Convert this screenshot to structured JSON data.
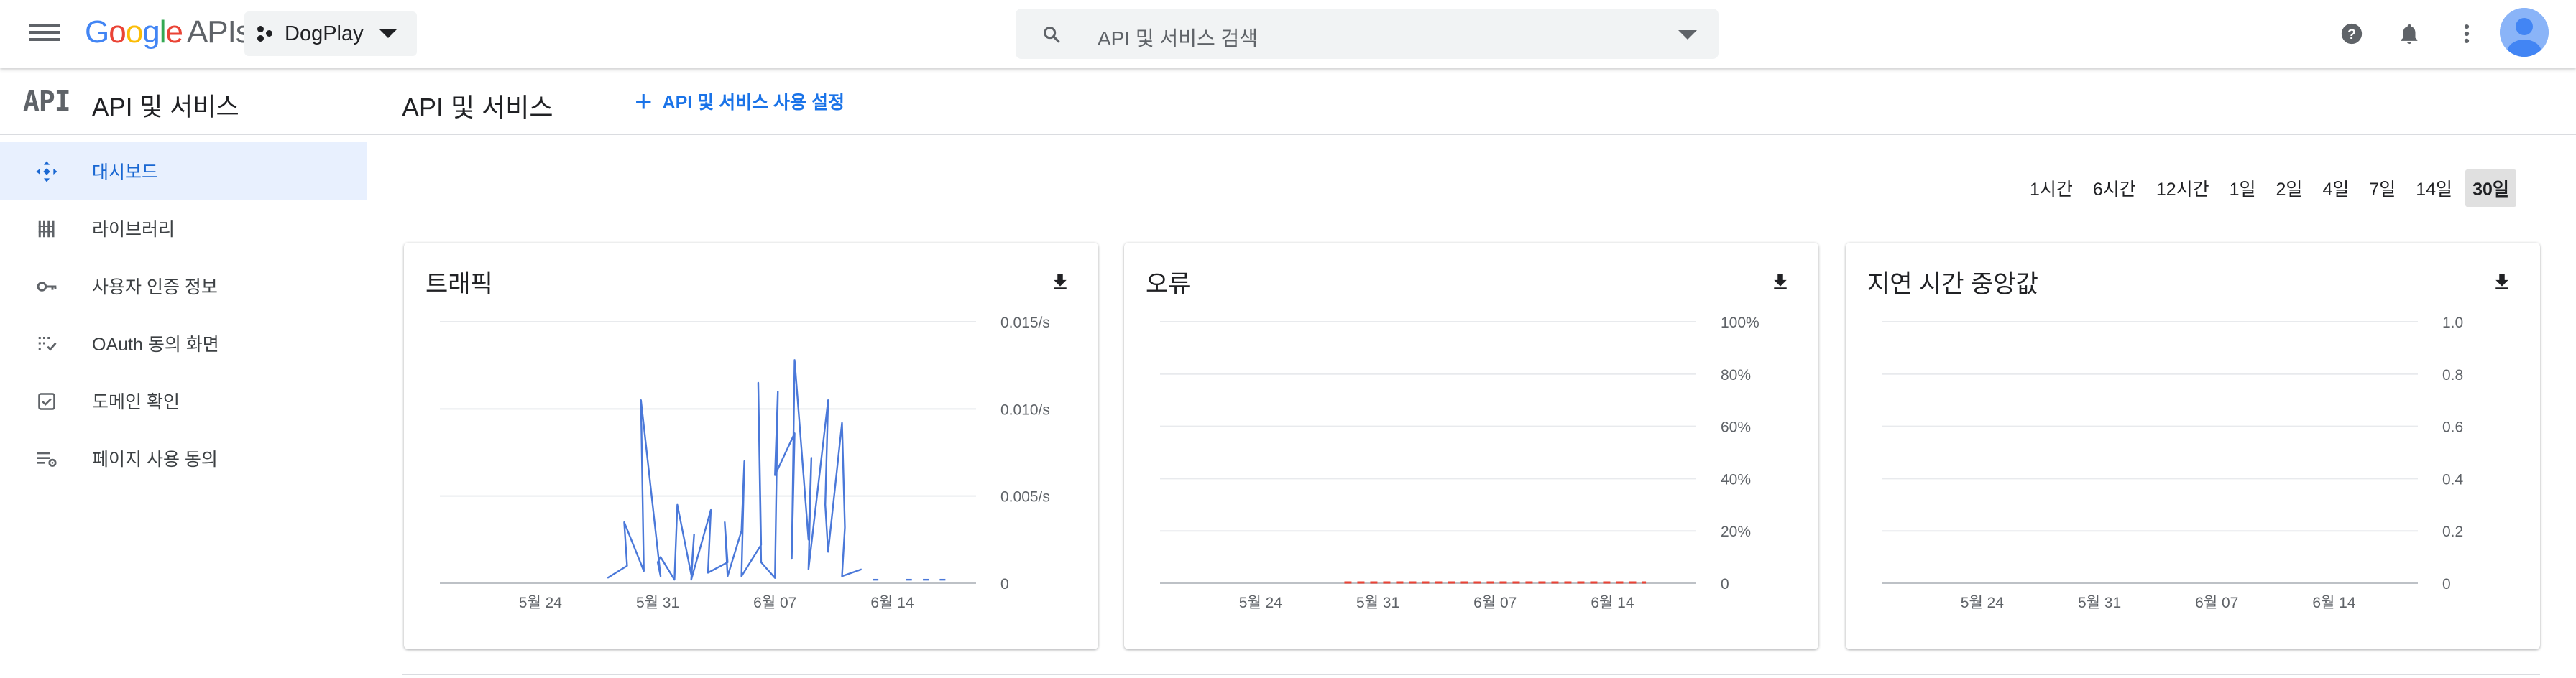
{
  "topbar": {
    "menu_icon": "hamburger-menu-icon",
    "brand_google": "Google",
    "brand_apis": "APIs",
    "project_name": "DogPlay",
    "search_placeholder": "API 및 서비스 검색",
    "help_icon": "help-icon",
    "notifications_icon": "bell-icon",
    "more_icon": "more-vert-icon"
  },
  "sidebar": {
    "logo_text": "API",
    "title": "API 및 서비스",
    "items": [
      {
        "label": "대시보드",
        "icon": "dashboard-icon",
        "active": true
      },
      {
        "label": "라이브러리",
        "icon": "library-icon",
        "active": false
      },
      {
        "label": "사용자 인증 정보",
        "icon": "key-icon",
        "active": false
      },
      {
        "label": "OAuth 동의 화면",
        "icon": "consent-icon",
        "active": false
      },
      {
        "label": "도메인 확인",
        "icon": "checkbox-icon",
        "active": false
      },
      {
        "label": "페이지 사용 동의",
        "icon": "settings-list-icon",
        "active": false
      }
    ]
  },
  "header": {
    "title": "API 및 서비스",
    "enable_button": "API 및 서비스 사용 설정"
  },
  "time_ranges": {
    "options": [
      "1시간",
      "6시간",
      "12시간",
      "1일",
      "2일",
      "4일",
      "7일",
      "14일",
      "30일"
    ],
    "selected": "30일"
  },
  "colors": {
    "accent": "#1a73e8",
    "active_bg": "#e8f0fe",
    "traffic_line": "#4a78d9",
    "error_line": "#ea4335"
  },
  "chart_data": [
    {
      "type": "line",
      "title": "트래픽",
      "x_tick_labels": [
        "5월 24",
        "5월 31",
        "6월 07",
        "6월 14"
      ],
      "y_tick_labels": [
        "0.015/s",
        "0.010/s",
        "0.005/s",
        "0"
      ],
      "ylim": [
        0,
        0.015
      ],
      "grid": true,
      "series": [
        {
          "x": [
            "5월 28",
            "5월 29",
            "5월 29",
            "5월 30",
            "5월 30",
            "5월 31",
            "5월 31",
            "5월 31",
            "6월 01",
            "6월 01",
            "6월 02",
            "6월 02",
            "6월 02",
            "6월 03",
            "6월 03",
            "6월 04",
            "6월 04",
            "6월 04",
            "6월 05",
            "6월 05",
            "6월 05",
            "6월 06",
            "6월 06",
            "6월 06",
            "6월 07",
            "6월 07",
            "6월 07",
            "6월 08",
            "6월 08",
            "6월 08",
            "6월 09",
            "6월 09",
            "6월 09",
            "6월 10",
            "6월 10",
            "6월 10",
            "6월 11",
            "6월 11",
            "6월 11",
            "6월 12"
          ],
          "y": [
            0.0003,
            0.001,
            0.0035,
            0.0007,
            0.0105,
            0.0004,
            0.0012,
            0.0015,
            0.0002,
            0.0045,
            0.0005,
            0.0028,
            0.0002,
            0.0042,
            0.0006,
            0.0012,
            0.0035,
            0.0004,
            0.003,
            0.007,
            0.0004,
            0.0022,
            0.0115,
            0.0012,
            0.0003,
            0.011,
            0.0062,
            0.0086,
            0.0014,
            0.0128,
            0.0025,
            0.0072,
            0.0008,
            0.0105,
            0.0045,
            0.0018,
            0.0092,
            0.0032,
            0.0004,
            0.0008
          ]
        }
      ],
      "sparse_marks": {
        "x": [
          "6월 13",
          "6월 15",
          "6월 16",
          "6월 17"
        ],
        "y": [
          0.0002,
          0.0002,
          0.0002,
          0.0002
        ]
      }
    },
    {
      "type": "line",
      "title": "오류",
      "x_tick_labels": [
        "5월 24",
        "5월 31",
        "6월 07",
        "6월 14"
      ],
      "y_tick_labels": [
        "100%",
        "80%",
        "60%",
        "40%",
        "20%",
        "0"
      ],
      "ylim": [
        0,
        100
      ],
      "grid": true,
      "series": [
        {
          "x_start": "5월 29",
          "x_end": "6월 16",
          "y": 0
        }
      ]
    },
    {
      "type": "line",
      "title": "지연 시간 중앙값",
      "x_tick_labels": [
        "5월 24",
        "5월 31",
        "6월 07",
        "6월 14"
      ],
      "y_tick_labels": [
        "1.0",
        "0.8",
        "0.6",
        "0.4",
        "0.2",
        "0"
      ],
      "ylim": [
        0,
        1.0
      ],
      "grid": true,
      "series": []
    }
  ],
  "cards": {
    "download_icon": "download-icon"
  }
}
